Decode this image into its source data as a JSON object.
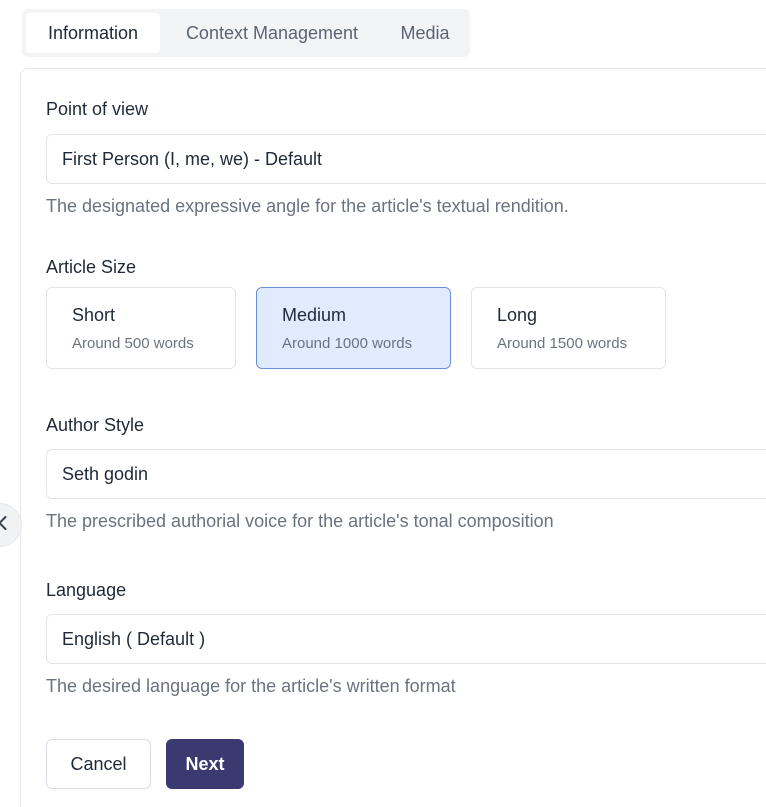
{
  "tabs": [
    {
      "label": "Information",
      "active": true
    },
    {
      "label": "Context Management",
      "active": false
    },
    {
      "label": "Media",
      "active": false
    }
  ],
  "point_of_view": {
    "label": "Point of view",
    "value": "First Person (I, me, we) - Default",
    "help": "The designated expressive angle for the article's textual rendition."
  },
  "article_size": {
    "label": "Article Size",
    "options": [
      {
        "title": "Short",
        "subtitle": "Around 500 words",
        "selected": false
      },
      {
        "title": "Medium",
        "subtitle": "Around 1000 words",
        "selected": true
      },
      {
        "title": "Long",
        "subtitle": "Around 1500 words",
        "selected": false
      }
    ]
  },
  "author_style": {
    "label": "Author Style",
    "value": "Seth godin",
    "help": "The prescribed authorial voice for the article's tonal composition"
  },
  "language": {
    "label": "Language",
    "value": "English ( Default )",
    "help": "The desired language for the article's written format"
  },
  "actions": {
    "cancel_label": "Cancel",
    "next_label": "Next"
  },
  "icons": {
    "collapse": "chevron-left-icon"
  },
  "colors": {
    "accent": "#3a3970",
    "selected_bg": "#e0ebfd",
    "selected_border": "#6b8fd6"
  }
}
